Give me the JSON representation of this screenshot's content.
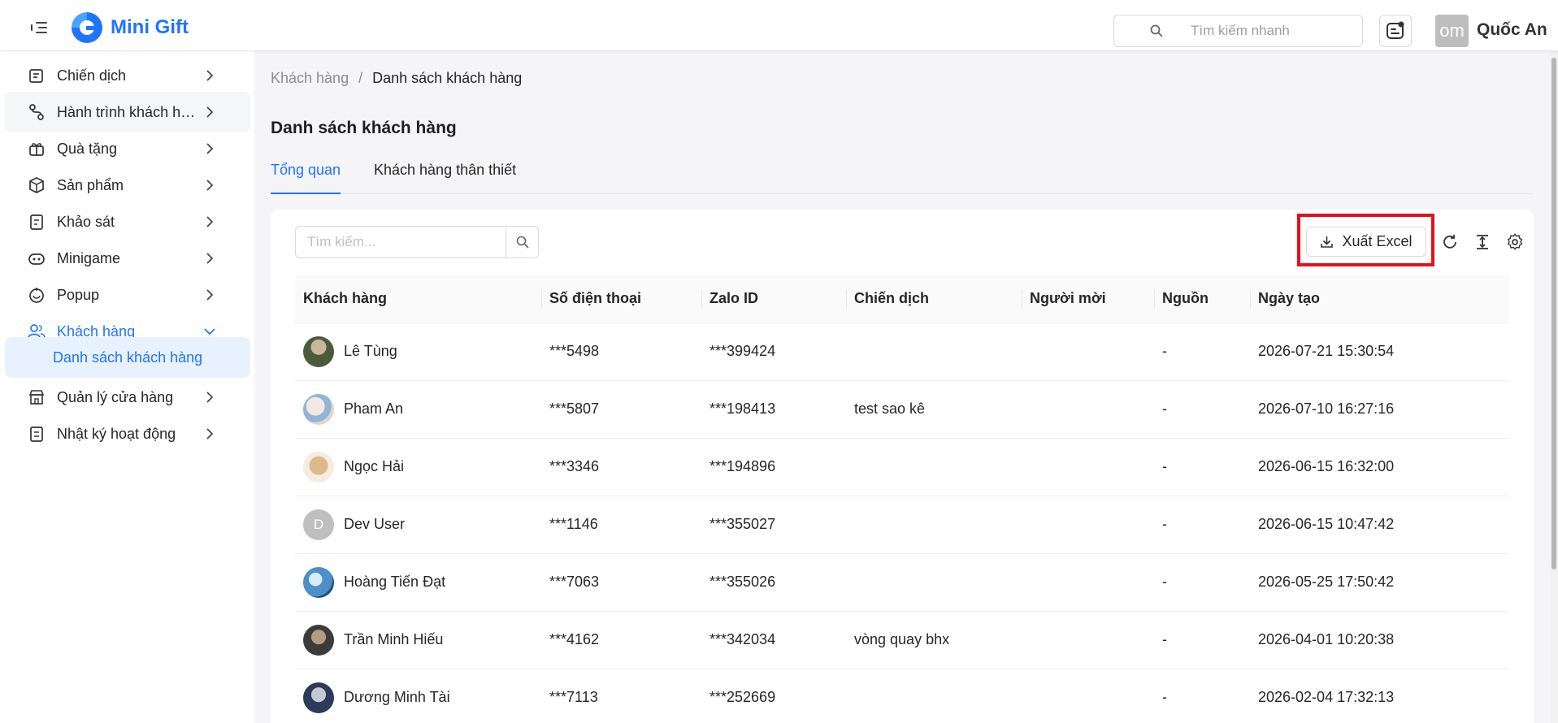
{
  "header": {
    "brand": "Mini Gift",
    "quick_search_placeholder": "Tìm kiếm nhanh",
    "user_avatar_text": "om",
    "user_name": "Quốc An"
  },
  "sidebar": {
    "items": [
      {
        "label": "Chiến dịch",
        "icon": "campaign-icon"
      },
      {
        "label": "Hành trình khách hàng",
        "icon": "journey-icon"
      },
      {
        "label": "Quà tặng",
        "icon": "gift-icon"
      },
      {
        "label": "Sản phẩm",
        "icon": "box-icon"
      },
      {
        "label": "Khảo sát",
        "icon": "survey-icon"
      },
      {
        "label": "Minigame",
        "icon": "gamepad-icon"
      },
      {
        "label": "Popup",
        "icon": "popup-icon"
      },
      {
        "label": "Khách hàng",
        "icon": "users-icon"
      },
      {
        "label": "Quản lý cửa hàng",
        "icon": "store-icon"
      },
      {
        "label": "Nhật ký hoạt động",
        "icon": "log-icon"
      }
    ],
    "sub_item": "Danh sách khách hàng"
  },
  "breadcrumb": {
    "parent": "Khách hàng",
    "separator": "/",
    "current": "Danh sách khách hàng"
  },
  "page_title": "Danh sách khách hàng",
  "tabs": [
    "Tổng quan",
    "Khách hàng thân thiết"
  ],
  "toolbar": {
    "search_placeholder": "Tìm kiếm...",
    "export_label": "Xuất Excel"
  },
  "table": {
    "columns": [
      "Khách hàng",
      "Số điện thoại",
      "Zalo ID",
      "Chiến dịch",
      "Người mời",
      "Nguồn",
      "Ngày tạo"
    ],
    "rows": [
      {
        "name": "Lê Tùng",
        "phone": "***5498",
        "zalo": "***399424",
        "campaign": "",
        "inviter": "",
        "source": "-",
        "created": "2026-07-21 15:30:54"
      },
      {
        "name": "Pham An",
        "phone": "***5807",
        "zalo": "***198413",
        "campaign": "test sao kê",
        "inviter": "",
        "source": "-",
        "created": "2026-07-10 16:27:16"
      },
      {
        "name": "Ngọc Hải",
        "phone": "***3346",
        "zalo": "***194896",
        "campaign": "",
        "inviter": "",
        "source": "-",
        "created": "2026-06-15 16:32:00"
      },
      {
        "name": "Dev User",
        "phone": "***1146",
        "zalo": "***355027",
        "campaign": "",
        "inviter": "",
        "source": "-",
        "created": "2026-06-15 10:47:42",
        "initial": "D"
      },
      {
        "name": "Hoàng Tiến Đạt",
        "phone": "***7063",
        "zalo": "***355026",
        "campaign": "",
        "inviter": "",
        "source": "-",
        "created": "2026-05-25 17:50:42"
      },
      {
        "name": "Trần Minh Hiếu",
        "phone": "***4162",
        "zalo": "***342034",
        "campaign": "vòng quay bhx",
        "inviter": "",
        "source": "-",
        "created": "2026-04-01 10:20:38"
      },
      {
        "name": "Dương Minh Tài",
        "phone": "***7113",
        "zalo": "***252669",
        "campaign": "",
        "inviter": "",
        "source": "-",
        "created": "2026-02-04 17:32:13"
      }
    ]
  },
  "colors": {
    "primary": "#1f74ff",
    "highlight": "#e3111c",
    "active_bg": "#e8f1fe"
  }
}
